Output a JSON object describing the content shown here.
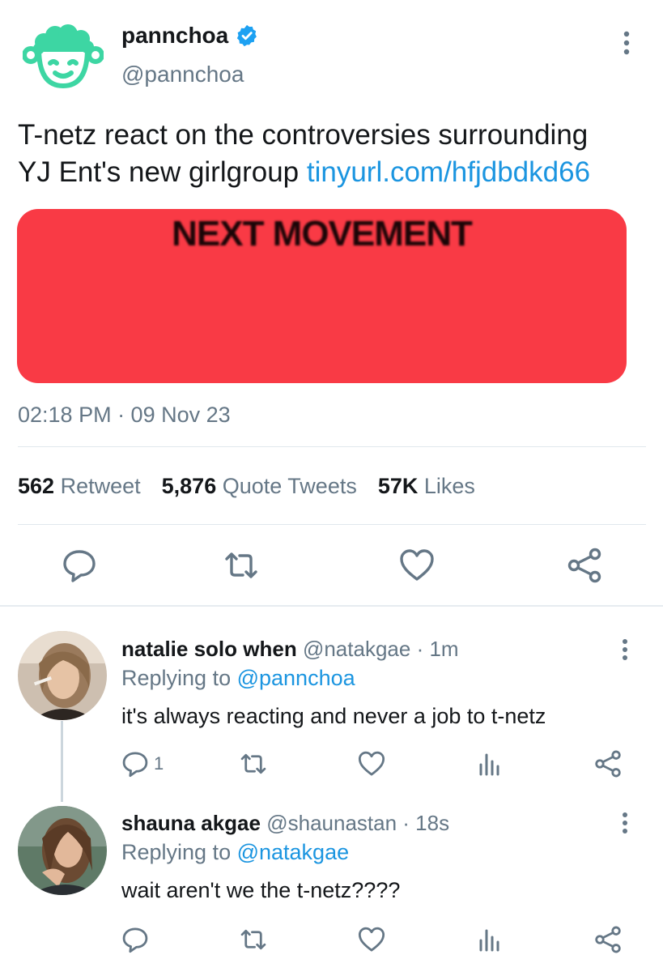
{
  "tweet": {
    "display_name": "pannchoa",
    "handle": "@pannchoa",
    "text_line1": "T-netz react on the controversies surrounding",
    "text_line2": "YJ Ent's new girlgroup ",
    "link": "tinyurl.com/hfjdbdkd66",
    "media_text": "NEXT MOVEMENT",
    "media_color": "#f93a45",
    "timestamp": "02:18 PM · 09 Nov 23",
    "stats": {
      "retweets": "562",
      "retweets_label": "Retweet",
      "quotes": "5,876",
      "quotes_label": "Quote Tweets",
      "likes": "57K",
      "likes_label": "Likes"
    }
  },
  "replies": [
    {
      "name": "natalie solo when",
      "handle": "@natakgae",
      "time": "· 1m",
      "replying_prefix": "Replying to ",
      "replying_to": "@pannchoa",
      "text": "it's always reacting and never a job to t-netz",
      "reply_count": "1"
    },
    {
      "name": "shauna akgae",
      "handle": "@shaunastan",
      "time": "· 18s",
      "replying_prefix": "Replying to ",
      "replying_to": "@natakgae",
      "text": "wait aren't we the t-netz????"
    }
  ],
  "colors": {
    "link": "#1b95e0",
    "secondary_text": "#657786",
    "verified": "#1da1f2",
    "logo": "#3dd6a3"
  },
  "icons": [
    "verified-badge-icon",
    "more-icon",
    "reply-icon",
    "retweet-icon",
    "like-icon",
    "share-icon",
    "analytics-icon"
  ]
}
